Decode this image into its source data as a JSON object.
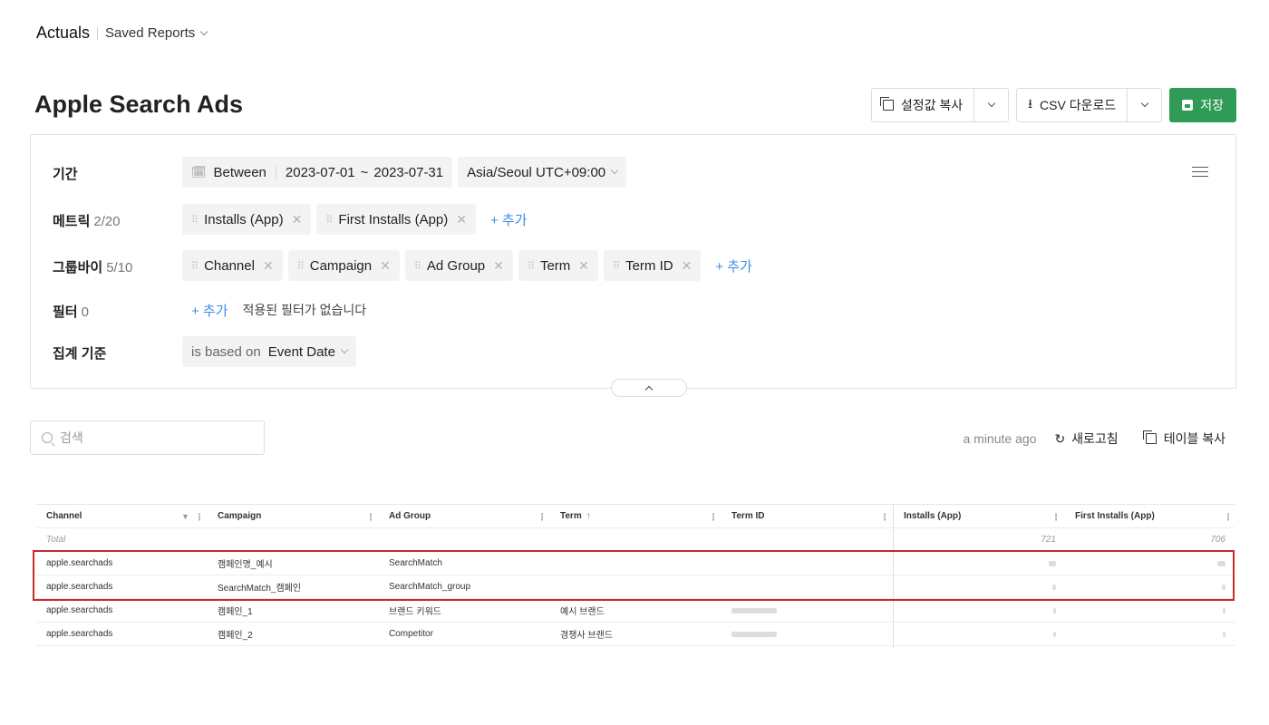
{
  "topbar": {
    "app": "Actuals",
    "saved_reports": "Saved Reports"
  },
  "page": {
    "title": "Apple Search Ads"
  },
  "actions": {
    "copy_settings": "설정값 복사",
    "csv_download": "CSV 다운로드",
    "save": "저장"
  },
  "config": {
    "period": {
      "label": "기간",
      "mode": "Between",
      "start": "2023-07-01",
      "tilde": "~",
      "end": "2023-07-31",
      "timezone": "Asia/Seoul UTC+09:00"
    },
    "metrics": {
      "label": "메트릭",
      "count": "2/20",
      "items": [
        "Installs (App)",
        "First Installs (App)"
      ],
      "add": "+ 추가"
    },
    "groupby": {
      "label": "그룹바이",
      "count": "5/10",
      "items": [
        "Channel",
        "Campaign",
        "Ad Group",
        "Term",
        "Term ID"
      ],
      "add": "+ 추가"
    },
    "filter": {
      "label": "필터",
      "count": "0",
      "add": "+ 추가",
      "empty": "적용된 필터가 없습니다"
    },
    "aggregation": {
      "label": "집계 기준",
      "prefix": "is based on",
      "value": "Event Date"
    }
  },
  "search": {
    "placeholder": "검색"
  },
  "table_actions": {
    "updated": "a minute ago",
    "refresh": "새로고침",
    "copy_table": "테이블 복사"
  },
  "table": {
    "columns": [
      "Channel",
      "Campaign",
      "Ad Group",
      "Term",
      "Term ID",
      "Installs (App)",
      "First Installs (App)"
    ],
    "sort_indicator": "↑",
    "total": {
      "label": "Total",
      "installs": "721",
      "first_installs": "706"
    },
    "rows": [
      {
        "channel": "apple.searchads",
        "campaign": "캠페인명_예시",
        "ad_group": "SearchMatch",
        "term": "",
        "term_id": ""
      },
      {
        "channel": "apple.searchads",
        "campaign": "SearchMatch_캠페인",
        "ad_group": "SearchMatch_group",
        "term": "",
        "term_id": ""
      },
      {
        "channel": "apple.searchads",
        "campaign": "캠페인_1",
        "ad_group": "브랜드 키워드",
        "term": "예시 브랜드",
        "term_id": ""
      },
      {
        "channel": "apple.searchads",
        "campaign": "캠페인_2",
        "ad_group": "Competitor",
        "term": "경쟁사 브랜드",
        "term_id": ""
      }
    ]
  },
  "colors": {
    "accent": "#3b8ee6",
    "save_green": "#2f9b57",
    "highlight_red": "#c92a2a"
  }
}
